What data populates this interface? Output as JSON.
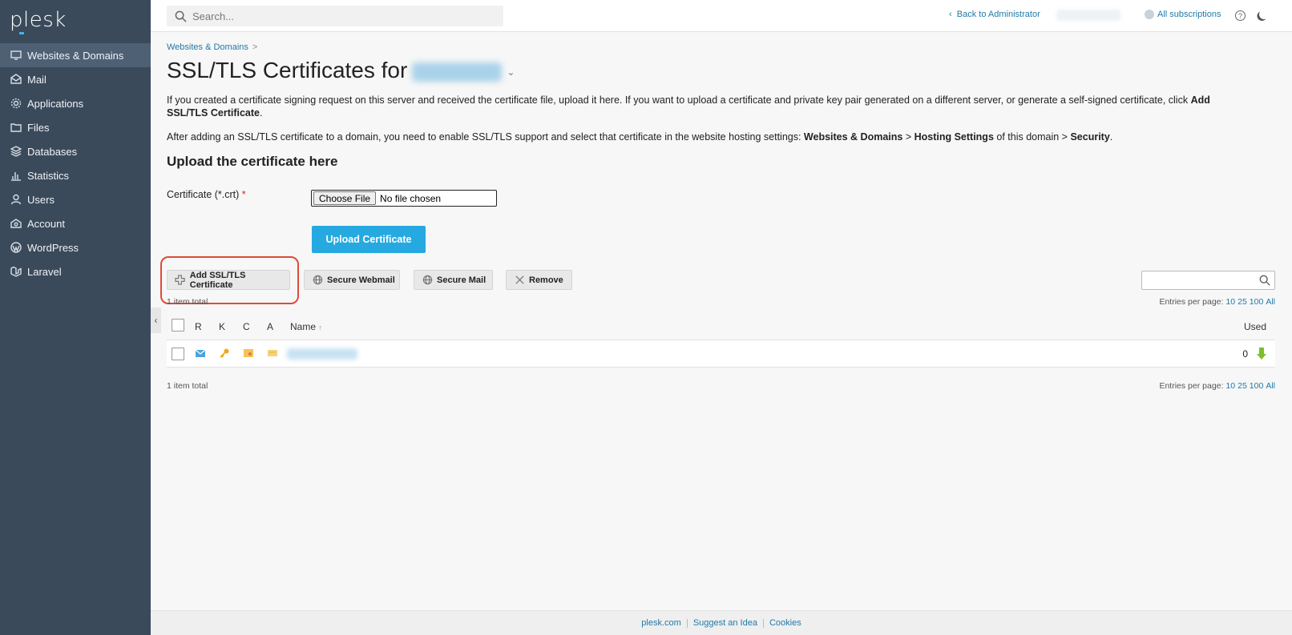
{
  "brand": {
    "logo": "plesk",
    "accent": "#3fb5e8",
    "sidebar_bg": "#3a4a5b"
  },
  "sidebar": {
    "items": [
      {
        "label": "Websites & Domains",
        "icon": "monitor-icon",
        "active": true
      },
      {
        "label": "Mail",
        "icon": "mail-icon"
      },
      {
        "label": "Applications",
        "icon": "gear-icon"
      },
      {
        "label": "Files",
        "icon": "folder-icon"
      },
      {
        "label": "Databases",
        "icon": "database-icon"
      },
      {
        "label": "Statistics",
        "icon": "bar-chart-icon"
      },
      {
        "label": "Users",
        "icon": "user-icon"
      },
      {
        "label": "Account",
        "icon": "account-icon"
      },
      {
        "label": "WordPress",
        "icon": "wordpress-icon"
      },
      {
        "label": "Laravel",
        "icon": "laravel-icon"
      }
    ],
    "collapse_glyph": "‹"
  },
  "topbar": {
    "search_placeholder": "Search...",
    "back_link": "Back to Administrator",
    "back_glyph": "‹",
    "subscriptions": "All subscriptions",
    "help_glyph": "?"
  },
  "breadcrumb": {
    "item": "Websites & Domains",
    "sep": ">"
  },
  "page": {
    "title_prefix": "SSL/TLS Certificates for",
    "title_caret": "⌄",
    "desc1_a": "If you created a certificate signing request on this server and received the certificate file, upload it here. If you want to upload a certificate and private key pair generated on a different server, or generate a self-signed certificate, click ",
    "desc1_b": "Add SSL/TLS Certificate",
    "desc1_c": ".",
    "desc2_a": "After adding an SSL/TLS certificate to a domain, you need to enable SSL/TLS support and select that certificate in the website hosting settings: ",
    "desc2_b": "Websites & Domains",
    "desc2_c": " > ",
    "desc2_d": "Hosting Settings",
    "desc2_e": " of this domain > ",
    "desc2_f": "Security",
    "desc2_g": ".",
    "upload_heading": "Upload the certificate here",
    "cert_label": "Certificate (*.crt)",
    "required_mark": "*",
    "choose_file": "Choose File",
    "no_file": "No file chosen",
    "upload_button": "Upload Certificate"
  },
  "toolbar": {
    "add": "Add SSL/TLS Certificate",
    "secure_webmail": "Secure Webmail",
    "secure_mail": "Secure Mail",
    "remove": "Remove"
  },
  "list": {
    "count_text": "1 item total",
    "epp_label": "Entries per page:",
    "epp_options": [
      "10",
      "25",
      "100",
      "All"
    ],
    "columns": {
      "r": "R",
      "k": "K",
      "c": "C",
      "a": "A",
      "name": "Name",
      "sort_glyph": "↑",
      "used": "Used"
    },
    "rows": [
      {
        "used": "0"
      }
    ]
  },
  "footer": {
    "links": [
      "plesk.com",
      "Suggest an Idea",
      "Cookies"
    ]
  }
}
